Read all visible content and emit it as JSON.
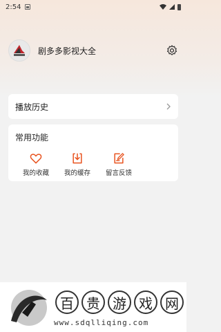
{
  "status_bar": {
    "time": "2:54"
  },
  "profile": {
    "app_name": "剧多多影视大全"
  },
  "history": {
    "label": "播放历史"
  },
  "features": {
    "title": "常用功能",
    "items": [
      {
        "label": "我的收藏",
        "icon": "heart-icon"
      },
      {
        "label": "我的缓存",
        "icon": "download-icon"
      },
      {
        "label": "留言反馈",
        "icon": "edit-icon"
      }
    ]
  },
  "watermark": {
    "chars": [
      "百",
      "贵",
      "游",
      "戏",
      "网"
    ],
    "url": "www.sdqlliqing.com"
  },
  "colors": {
    "accent": "#e8531f"
  }
}
